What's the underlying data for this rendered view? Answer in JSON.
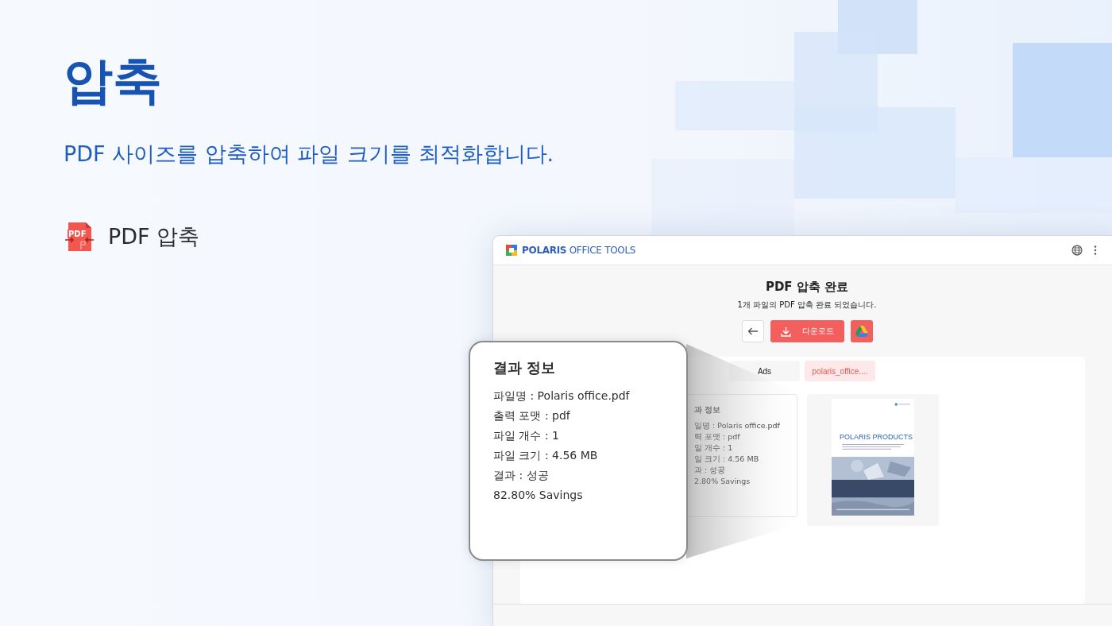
{
  "hero": {
    "title": "압축",
    "subtitle": "PDF 사이즈를 압축하여 파일 크기를 최적화합니다.",
    "features": [
      {
        "label": "PDF 압축",
        "icon_text": "PDF"
      }
    ]
  },
  "app": {
    "brand": "**POLARIS** OFFICE TOOLS",
    "heading": "PDF 압축 완료",
    "message": "1개 파일의 PDF 압축 완료 되었습니다.",
    "download_button": "다운로드",
    "tabs": [
      {
        "label": "Ads",
        "selected": false
      },
      {
        "label": "polaris_office....",
        "selected": true
      }
    ],
    "result_card": {
      "title": "과 정보",
      "lines": [
        "일명 : Polaris office.pdf",
        "력 포맷 : pdf",
        "일 개수 : 1",
        "일 크기 : 4.56 MB",
        "과 : 성공",
        "2.80% Savings"
      ]
    },
    "thumbnail": {
      "title": "POLARIS PRODUCTS"
    }
  },
  "callout": {
    "title": "결과 정보",
    "lines": [
      "파일명 : Polaris office.pdf",
      "출력 포맷 : pdf",
      "파일 개수 : 1",
      "파일 크기 : 4.56 MB",
      "결과 : 성공",
      "82.80% Savings"
    ]
  }
}
